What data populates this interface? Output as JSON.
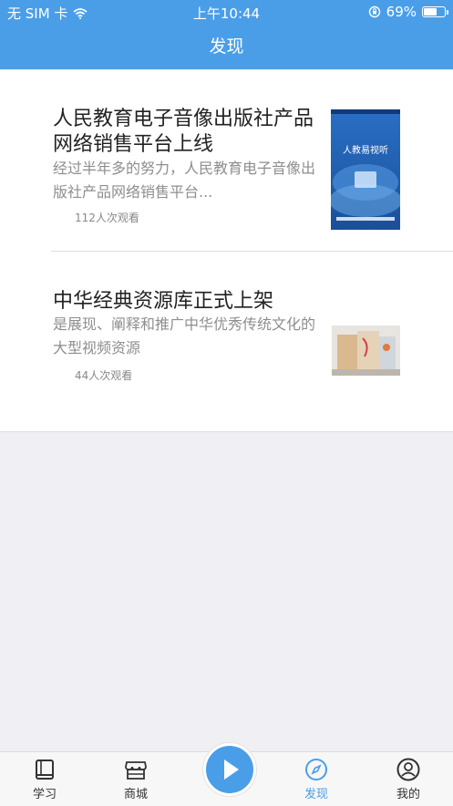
{
  "status_bar": {
    "carrier": "无 SIM 卡",
    "time": "上午10:44",
    "battery_percent": "69%",
    "battery_level": 0.69
  },
  "nav": {
    "title": "发现"
  },
  "items": [
    {
      "title": "人民教育电子音像出版社产品网络销售平台上线",
      "desc": "经过半年多的努力，人民教育电子音像出版社产品网络销售平台...",
      "views": "112人次观看",
      "thumb_text": "人教易视听"
    },
    {
      "title": "中华经典资源库正式上架",
      "desc": "是展现、阐释和推广中华优秀传统文化的大型视频资源",
      "views": "44人次观看"
    }
  ],
  "tabs": [
    {
      "label": "学习",
      "icon": "book-icon"
    },
    {
      "label": "商城",
      "icon": "store-icon"
    },
    {
      "label": "",
      "icon": "play-icon"
    },
    {
      "label": "发现",
      "icon": "compass-icon",
      "active": true
    },
    {
      "label": "我的",
      "icon": "person-icon"
    }
  ],
  "colors": {
    "primary": "#4a9ee8",
    "background": "#efeff4"
  }
}
